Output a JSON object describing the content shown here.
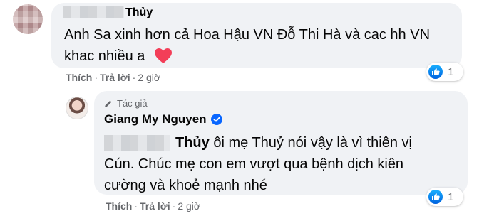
{
  "comment": {
    "name_suffix": "Thủy",
    "text_line1": "Anh Sa xinh hơn cả Hoa Hậu VN Đỗ Thi Hà và cac hh VN",
    "text_line2": "khac nhiều a",
    "like_label": "Thích",
    "reply_label": "Trả lời",
    "time": "2 giờ",
    "reaction_count": "1"
  },
  "reply": {
    "author_tag": "Tác giả",
    "author_name": "Giang My Nguyen",
    "mention_suffix": "Thủy",
    "text_line1": "ôi mẹ Thuỷ nói vậy là vì thiên vị",
    "text_line2": "Cún. Chúc mẹ con em vượt qua bệnh dịch kiên",
    "text_line3": "cường và khoẻ mạnh nhé",
    "like_label": "Thích",
    "reply_label": "Trả lời",
    "time": "2 giờ",
    "reaction_count": "1"
  },
  "separator": "·",
  "colors": {
    "bubble": "#f0f2f5",
    "meta_text": "#65676b",
    "like_blue": "#0866ff",
    "heart_red": "#f33e58"
  },
  "icons": {
    "reaction": "like-icon",
    "author_badge": "pen-icon",
    "verified": "verified-badge-icon",
    "emoji": "red-heart-icon"
  }
}
